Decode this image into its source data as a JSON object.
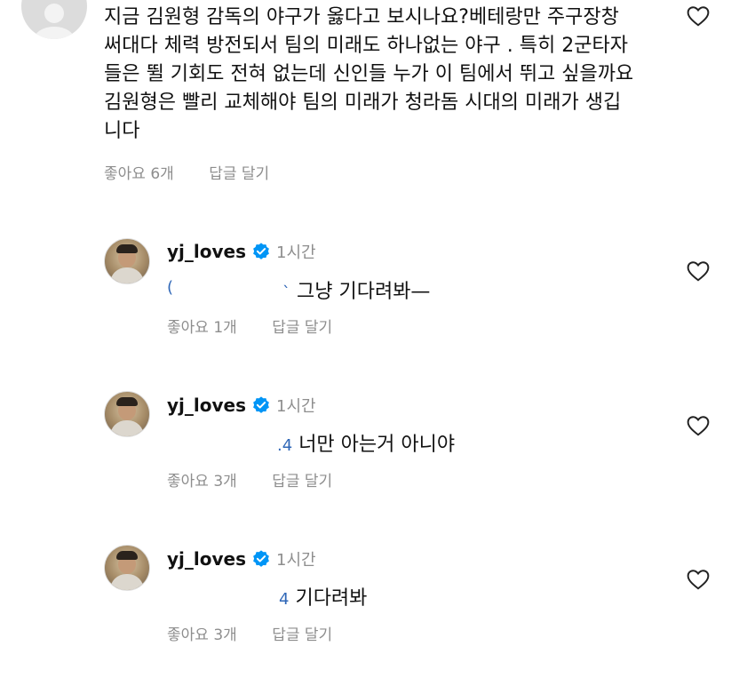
{
  "comment": {
    "text": "지금 김원형 감독의 야구가 옳다고 보시나요?베테랑만 주구장창 써대다 체력 방전되서 팀의 미래도 하나없는 야구 . 특히 2군타자들은 뛸 기회도 전혀 없는데 신인들 누가 이 팀에서 뛰고 싶을까요 김원형은 빨리 교체해야 팀의 미래가 청라돔 시대의 미래가 생깁니다",
    "likes": "좋아요 6개",
    "reply": "답글 달기"
  },
  "replies": [
    {
      "username": "yj_loves",
      "time": "1시간",
      "prefix": "(",
      "mid_mark": "`",
      "text": "그냥 기다려봐—",
      "likes": "좋아요 1개",
      "reply": "답글 달기"
    },
    {
      "username": "yj_loves",
      "time": "1시간",
      "mid_mark": ".4",
      "text": "너만 아는거 아니야",
      "likes": "좋아요 3개",
      "reply": "답글 달기"
    },
    {
      "username": "yj_loves",
      "time": "1시간",
      "mid_mark": "4",
      "text": "기다려봐",
      "likes": "좋아요 3개",
      "reply": "답글 달기"
    }
  ],
  "icons": {
    "like": "heart-outline-icon",
    "verified": "verified-badge-icon",
    "verified_color": "#0095f6"
  }
}
